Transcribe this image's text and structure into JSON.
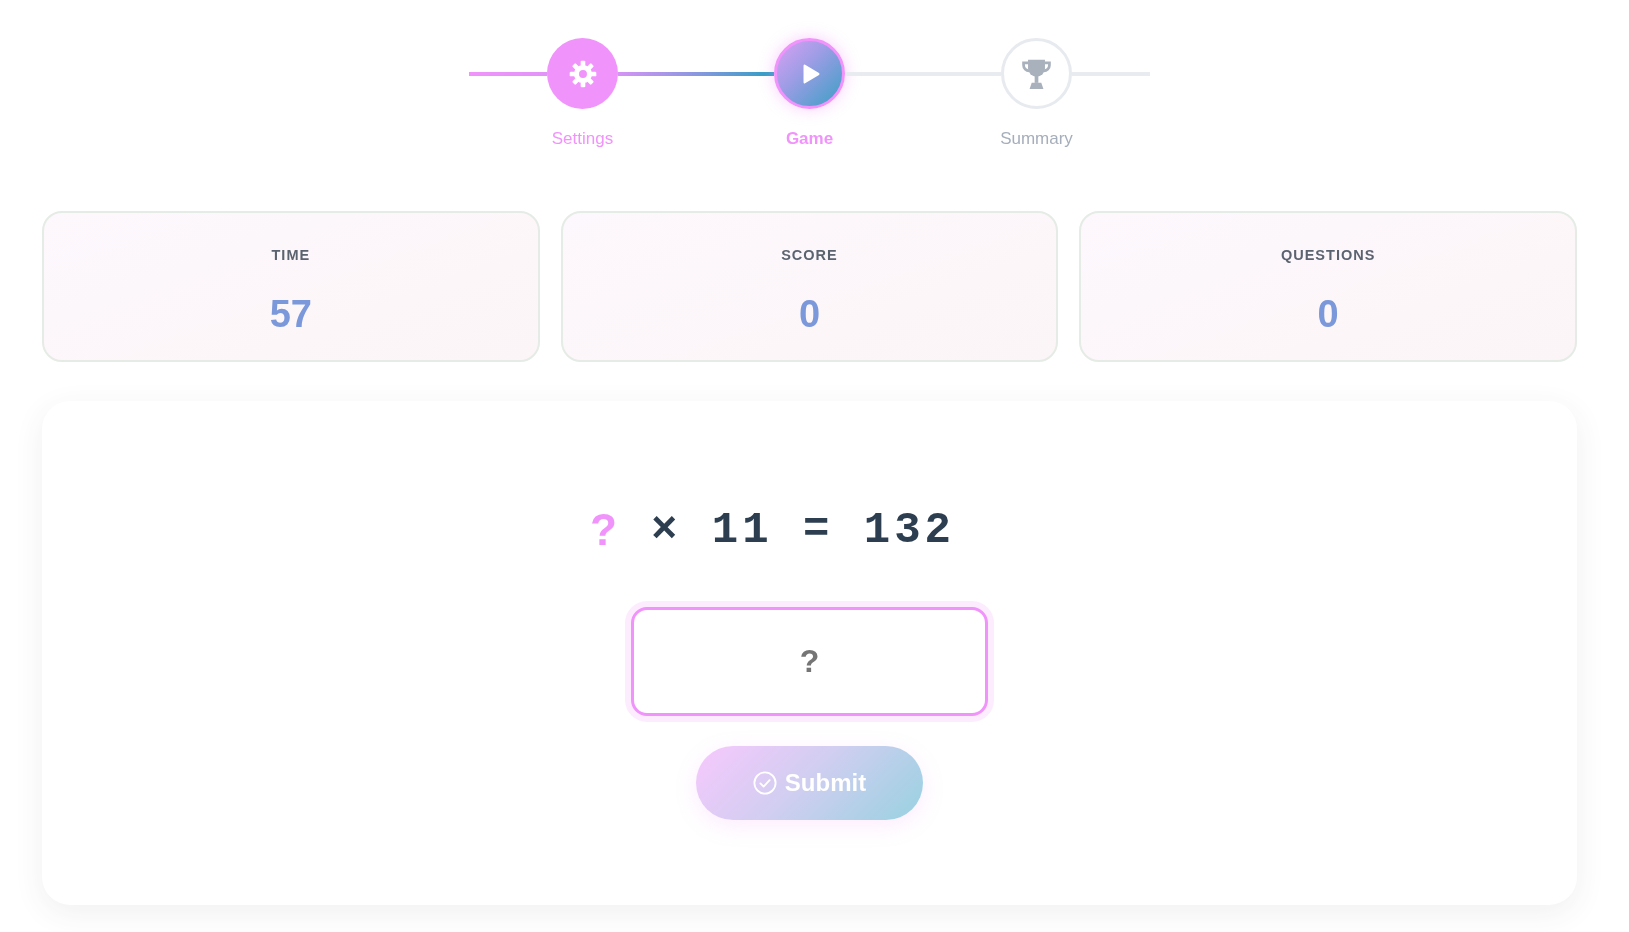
{
  "steps": [
    {
      "label": "Settings",
      "completed": true,
      "selected": false
    },
    {
      "label": "Game",
      "completed": false,
      "selected": true
    },
    {
      "label": "Summary",
      "completed": false,
      "selected": false
    }
  ],
  "stats": [
    {
      "label": "TIME",
      "value": "57"
    },
    {
      "label": "SCORE",
      "value": "0"
    },
    {
      "label": "QUESTIONS",
      "value": "0"
    }
  ],
  "question": {
    "unknown": "?",
    "expression": "× 11 = 132"
  },
  "answer_field": {
    "placeholder": "?"
  },
  "submit_button": {
    "label": "Submit",
    "disabled": true
  }
}
